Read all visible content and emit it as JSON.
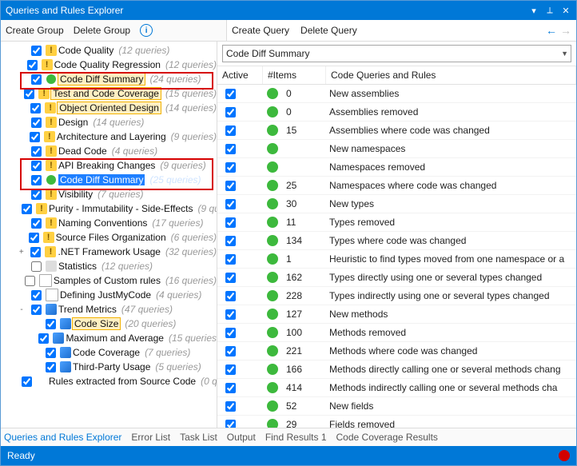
{
  "titlebar": {
    "title": "Queries and Rules Explorer"
  },
  "toolbarLeft": {
    "createGroup": "Create Group",
    "deleteGroup": "Delete Group"
  },
  "toolbarRight": {
    "createQuery": "Create Query",
    "deleteQuery": "Delete Query"
  },
  "combo": {
    "value": "Code Diff Summary"
  },
  "headers": {
    "active": "Active",
    "items": "#Items",
    "name": "Code Queries and Rules"
  },
  "tree": {
    "items": [
      {
        "label": "Code Quality",
        "count": "(12 queries)",
        "icon": "warn",
        "ind": 1
      },
      {
        "label": "Code Quality Regression",
        "count": "(12 queries)",
        "icon": "warn",
        "ind": 1
      },
      {
        "label": "Code Diff Summary",
        "count": "(24 queries)",
        "icon": "green",
        "ind": 1,
        "hl": "orange"
      },
      {
        "label": "Test and Code Coverage",
        "count": "(15 queries)",
        "icon": "warn",
        "ind": 1,
        "hl": "orange"
      },
      {
        "label": "Object Oriented Design",
        "count": "(14 queries)",
        "icon": "warn",
        "ind": 1,
        "hl": "orange"
      },
      {
        "label": "Design",
        "count": "(14 queries)",
        "icon": "warn",
        "ind": 1
      },
      {
        "label": "Architecture and Layering",
        "count": "(9 queries)",
        "icon": "warn",
        "ind": 1
      },
      {
        "label": "Dead Code",
        "count": "(4 queries)",
        "icon": "warn",
        "ind": 1
      },
      {
        "label": "API Breaking Changes",
        "count": "(9 queries)",
        "icon": "warn",
        "ind": 1
      },
      {
        "label": "Code Diff Summary",
        "count": "(25 queries)",
        "icon": "green",
        "ind": 1,
        "hl": "blue"
      },
      {
        "label": "Visibility",
        "count": "(7 queries)",
        "icon": "warn",
        "ind": 1
      },
      {
        "label": "Purity - Immutability - Side-Effects",
        "count": "(9 qu",
        "icon": "warn",
        "ind": 1
      },
      {
        "label": "Naming Conventions",
        "count": "(17 queries)",
        "icon": "warn",
        "ind": 1
      },
      {
        "label": "Source Files Organization",
        "count": "(6 queries)",
        "icon": "warn",
        "ind": 1
      },
      {
        "label": ".NET Framework Usage",
        "count": "(32 queries)",
        "icon": "warn",
        "ind": 1,
        "twisty": "+"
      },
      {
        "label": "Statistics",
        "count": "(12 queries)",
        "icon": "stats",
        "ind": 1,
        "unchecked": true
      },
      {
        "label": "Samples of Custom rules",
        "count": "(16 queries)",
        "icon": "doc",
        "ind": 1,
        "unchecked": true
      },
      {
        "label": "Defining JustMyCode",
        "count": "(4 queries)",
        "icon": "doc",
        "ind": 1
      },
      {
        "label": "Trend Metrics",
        "count": "(47 queries)",
        "icon": "metric",
        "ind": 1,
        "twisty": "-"
      },
      {
        "label": "Code Size",
        "count": "(20 queries)",
        "icon": "metric",
        "ind": 2,
        "hl": "orange"
      },
      {
        "label": "Maximum and Average",
        "count": "(15 queries",
        "icon": "metric",
        "ind": 2
      },
      {
        "label": "Code Coverage",
        "count": "(7 queries)",
        "icon": "metric",
        "ind": 2
      },
      {
        "label": "Third-Party Usage",
        "count": "(5 queries)",
        "icon": "metric",
        "ind": 2
      },
      {
        "label": "Rules extracted from Source Code",
        "count": "(0 qu",
        "icon": "none",
        "ind": 1
      }
    ]
  },
  "rows": [
    {
      "items": "0",
      "name": "New assemblies"
    },
    {
      "items": "0",
      "name": "Assemblies removed"
    },
    {
      "items": "15",
      "name": "Assemblies where code was changed"
    },
    {
      "items": "",
      "name": "New namespaces"
    },
    {
      "items": "",
      "name": "Namespaces removed"
    },
    {
      "items": "25",
      "name": "Namespaces where code was changed"
    },
    {
      "items": "30",
      "name": "New types"
    },
    {
      "items": "11",
      "name": "Types removed"
    },
    {
      "items": "134",
      "name": "Types where code was changed"
    },
    {
      "items": "1",
      "name": "Heuristic to find types moved from one namespace or a"
    },
    {
      "items": "162",
      "name": "Types directly using one or several types changed"
    },
    {
      "items": "228",
      "name": "Types indirectly using one or several types changed"
    },
    {
      "items": "127",
      "name": "New methods"
    },
    {
      "items": "100",
      "name": "Methods removed"
    },
    {
      "items": "221",
      "name": "Methods where code was changed"
    },
    {
      "items": "166",
      "name": "Methods directly calling one or several methods chang"
    },
    {
      "items": "414",
      "name": "Methods indirectly calling one or several methods cha"
    },
    {
      "items": "52",
      "name": "New fields"
    },
    {
      "items": "29",
      "name": "Fields removed"
    }
  ],
  "tabs": {
    "items": [
      "Queries and Rules Explorer",
      "Error List",
      "Task List",
      "Output",
      "Find Results 1",
      "Code Coverage Results"
    ],
    "activeIndex": 0
  },
  "status": {
    "text": "Ready"
  }
}
